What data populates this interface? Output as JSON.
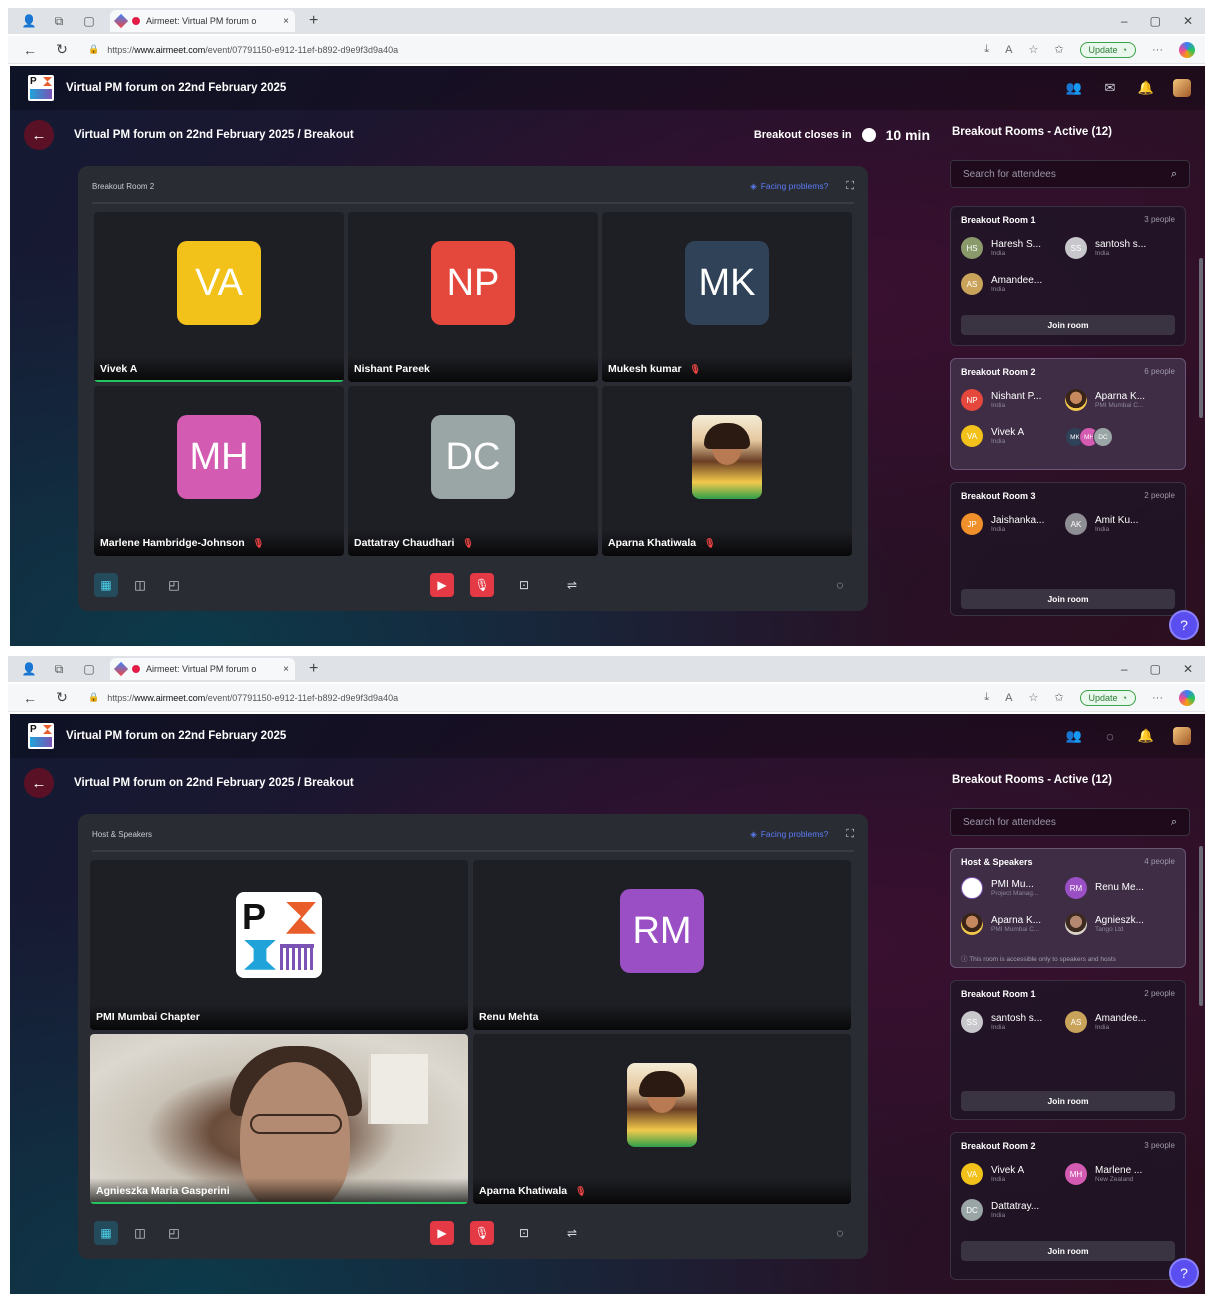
{
  "browser": {
    "tab_title": "Airmeet: Virtual PM forum o",
    "tab_close": "×",
    "new_tab": "+",
    "url_prefix": "https://",
    "url_domain": "www.airmeet.com",
    "url_path": "/event/07791150-e912-11ef-b892-d9e9f3d9a40a",
    "update_label": "Update"
  },
  "app": {
    "event_title": "Virtual PM forum on 22nd February 2025",
    "breadcrumb": "Virtual PM forum on 22nd February 2025 / Breakout",
    "breakout_closes_label": "Breakout closes in",
    "breakout_closes_value": "10 min",
    "facing_problems": "Facing problems?"
  },
  "sidebar": {
    "title": "Breakout Rooms - Active (12)",
    "search_placeholder": "Search for attendees",
    "join_label": "Join room"
  },
  "shot1": {
    "stage_title": "Breakout Room 2",
    "tiles": [
      {
        "initials": "VA",
        "color": "#f2c21b",
        "name": "Vivek A",
        "muted": false,
        "speaking": true
      },
      {
        "initials": "NP",
        "color": "#e4473c",
        "name": "Nishant Pareek",
        "muted": false
      },
      {
        "initials": "MK",
        "color": "#2f4257",
        "name": "Mukesh kumar",
        "muted": true
      },
      {
        "initials": "MH",
        "color": "#d45bb2",
        "name": "Marlene Hambridge-Johnson",
        "muted": true
      },
      {
        "initials": "DC",
        "color": "#9aa5a6",
        "name": "Dattatray Chaudhari",
        "muted": true
      },
      {
        "initials": "",
        "name": "Aparna Khatiwala",
        "muted": true,
        "photo": true
      }
    ],
    "rooms": [
      {
        "name": "Breakout Room 1",
        "count": "3 people",
        "members": [
          {
            "initials": "HS",
            "color": "#8a9a6a",
            "name": "Haresh S...",
            "sub": "India"
          },
          {
            "initials": "SS",
            "color": "#c8c8cc",
            "name": "santosh s...",
            "sub": "India"
          },
          {
            "initials": "AS",
            "color": "#c9a35a",
            "name": "Amandee...",
            "sub": "India"
          }
        ]
      },
      {
        "name": "Breakout Room 2",
        "count": "6 people",
        "members": [
          {
            "initials": "NP",
            "color": "#e4473c",
            "name": "Nishant P...",
            "sub": "India"
          },
          {
            "initials": "",
            "name": "Aparna K...",
            "sub": "PMI Mumbai C...",
            "photo": true
          },
          {
            "initials": "VA",
            "color": "#f2c21b",
            "name": "Vivek A",
            "sub": "India"
          }
        ],
        "stack": [
          {
            "initials": "MK",
            "color": "#2f4257"
          },
          {
            "initials": "MH",
            "color": "#d45bb2"
          },
          {
            "initials": "DC",
            "color": "#9aa5a6"
          }
        ]
      },
      {
        "name": "Breakout Room 3",
        "count": "2 people",
        "members": [
          {
            "initials": "JP",
            "color": "#f0902a",
            "name": "Jaishanka...",
            "sub": "India"
          },
          {
            "initials": "AK",
            "color": "#8e8e95",
            "name": "Amit Ku...",
            "sub": "India"
          }
        ]
      }
    ]
  },
  "shot2": {
    "stage_title": "Host & Speakers",
    "tiles": [
      {
        "name": "PMI Mumbai Chapter",
        "logo": true
      },
      {
        "initials": "RM",
        "color": "#9b4fc4",
        "name": "Renu Mehta"
      },
      {
        "name": "Agnieszka Maria Gasperini",
        "video": true,
        "speaking": true
      },
      {
        "name": "Aparna Khatiwala",
        "muted": true,
        "photo": true
      }
    ],
    "rooms": [
      {
        "name": "Host & Speakers",
        "count": "4 people",
        "members": [
          {
            "initials": "",
            "name": "PMI Mu...",
            "sub": "Project Manag...",
            "photo": true
          },
          {
            "initials": "RM",
            "color": "#9b4fc4",
            "name": "Renu Me...",
            "sub": ""
          },
          {
            "initials": "",
            "name": "Aparna K...",
            "sub": "PMI Mumbai C...",
            "photo": true
          },
          {
            "initials": "",
            "name": "Agnieszk...",
            "sub": "Tango Ltd",
            "photo": true
          }
        ],
        "note": "This room is accessible only to speakers and hosts"
      },
      {
        "name": "Breakout Room 1",
        "count": "2 people",
        "members": [
          {
            "initials": "SS",
            "color": "#c8c8cc",
            "name": "santosh s...",
            "sub": "India"
          },
          {
            "initials": "AS",
            "color": "#c9a35a",
            "name": "Amandee...",
            "sub": "India"
          }
        ]
      },
      {
        "name": "Breakout Room 2",
        "count": "3 people",
        "members": [
          {
            "initials": "VA",
            "color": "#f2c21b",
            "name": "Vivek A",
            "sub": "India"
          },
          {
            "initials": "MH",
            "color": "#d45bb2",
            "name": "Marlene ...",
            "sub": "New Zealand"
          },
          {
            "initials": "DC",
            "color": "#9aa5a6",
            "name": "Dattatray...",
            "sub": "India"
          }
        ]
      }
    ]
  }
}
